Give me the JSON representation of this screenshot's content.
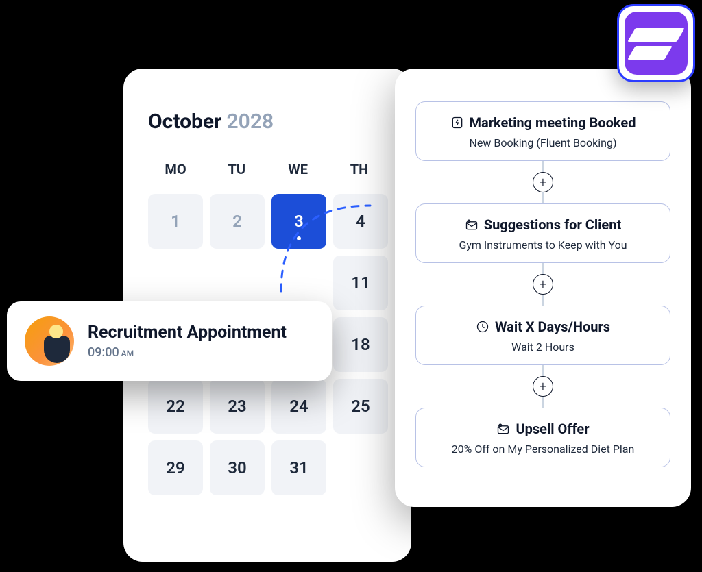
{
  "calendar": {
    "month": "October",
    "year": "2028",
    "dow": [
      "MO",
      "TU",
      "WE",
      "TH"
    ],
    "days": [
      {
        "n": "1",
        "muted": true
      },
      {
        "n": "2",
        "muted": true
      },
      {
        "n": "3",
        "selected": true
      },
      {
        "n": "4"
      },
      {
        "n": ""
      },
      {
        "n": ""
      },
      {
        "n": ""
      },
      {
        "n": "11"
      },
      {
        "n": ""
      },
      {
        "n": ""
      },
      {
        "n": ""
      },
      {
        "n": "18"
      },
      {
        "n": "22"
      },
      {
        "n": "23"
      },
      {
        "n": "24"
      },
      {
        "n": "25"
      },
      {
        "n": "29"
      },
      {
        "n": "30"
      },
      {
        "n": "31"
      },
      {
        "n": ""
      }
    ]
  },
  "event": {
    "title": "Recruitment Appointment",
    "time": "09:00",
    "ampm": "AM"
  },
  "flow": {
    "steps": [
      {
        "icon": "bolt",
        "title": "Marketing meeting Booked",
        "sub": "New Booking (Fluent Booking)"
      },
      {
        "icon": "mail",
        "title": "Suggestions for Client",
        "sub": "Gym Instruments to Keep with You"
      },
      {
        "icon": "clock",
        "title": "Wait X Days/Hours",
        "sub": "Wait 2 Hours"
      },
      {
        "icon": "mail",
        "title": "Upsell Offer",
        "sub": "20% Off on My Personalized Diet Plan"
      }
    ],
    "add_label": "+"
  }
}
